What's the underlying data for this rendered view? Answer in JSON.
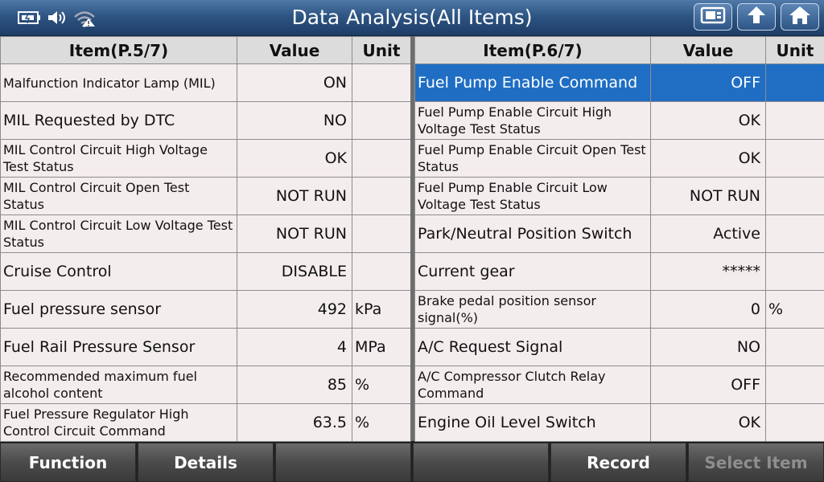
{
  "header": {
    "title": "Data Analysis(All Items)",
    "status_icons": [
      "battery-icon",
      "speaker-icon",
      "wifi-icon"
    ],
    "buttons": [
      "record-screen-icon",
      "back-up-arrow-icon",
      "home-icon"
    ]
  },
  "left_table": {
    "headers": {
      "item": "Item(P.5/7)",
      "value": "Value",
      "unit": "Unit"
    },
    "rows": [
      {
        "item": "Malfunction Indicator Lamp (MIL)",
        "value": "ON",
        "unit": ""
      },
      {
        "item": "MIL Requested by DTC",
        "value": "NO",
        "unit": ""
      },
      {
        "item": "MIL Control Circuit High Voltage Test Status",
        "value": "OK",
        "unit": ""
      },
      {
        "item": "MIL Control Circuit Open Test Status",
        "value": "NOT RUN",
        "unit": ""
      },
      {
        "item": "MIL Control Circuit Low Voltage Test Status",
        "value": "NOT RUN",
        "unit": ""
      },
      {
        "item": "Cruise Control",
        "value": "DISABLE",
        "unit": ""
      },
      {
        "item": "Fuel pressure sensor",
        "value": "492",
        "unit": "kPa"
      },
      {
        "item": "Fuel Rail Pressure Sensor",
        "value": "4",
        "unit": "MPa"
      },
      {
        "item": "Recommended maximum fuel alcohol content",
        "value": "85",
        "unit": "%"
      },
      {
        "item": "Fuel Pressure Regulator High Control Circuit Command",
        "value": "63.5",
        "unit": "%"
      }
    ]
  },
  "right_table": {
    "headers": {
      "item": "Item(P.6/7)",
      "value": "Value",
      "unit": "Unit"
    },
    "rows": [
      {
        "item": "Fuel Pump Enable Command",
        "value": "OFF",
        "unit": ""
      },
      {
        "item": "Fuel Pump Enable Circuit High Voltage Test Status",
        "value": "OK",
        "unit": ""
      },
      {
        "item": "Fuel Pump Enable Circuit Open Test Status",
        "value": "OK",
        "unit": ""
      },
      {
        "item": "Fuel Pump Enable Circuit Low Voltage Test Status",
        "value": "NOT RUN",
        "unit": ""
      },
      {
        "item": "Park/Neutral Position Switch",
        "value": "Active",
        "unit": ""
      },
      {
        "item": "Current gear",
        "value": "*****",
        "unit": ""
      },
      {
        "item": "Brake pedal position sensor signal(%)",
        "value": "0",
        "unit": "%"
      },
      {
        "item": "A/C Request Signal",
        "value": "NO",
        "unit": ""
      },
      {
        "item": "A/C Compressor Clutch Relay Command",
        "value": "OFF",
        "unit": ""
      },
      {
        "item": "Engine Oil Level Switch",
        "value": "OK",
        "unit": ""
      }
    ]
  },
  "footer": {
    "buttons": [
      "Function",
      "Details",
      "",
      "",
      "Record",
      "Select Item"
    ]
  },
  "colors": {
    "selected_row": "#1f6ec4",
    "header_bar": "#2e5583",
    "cell_bg": "#f4eded"
  }
}
